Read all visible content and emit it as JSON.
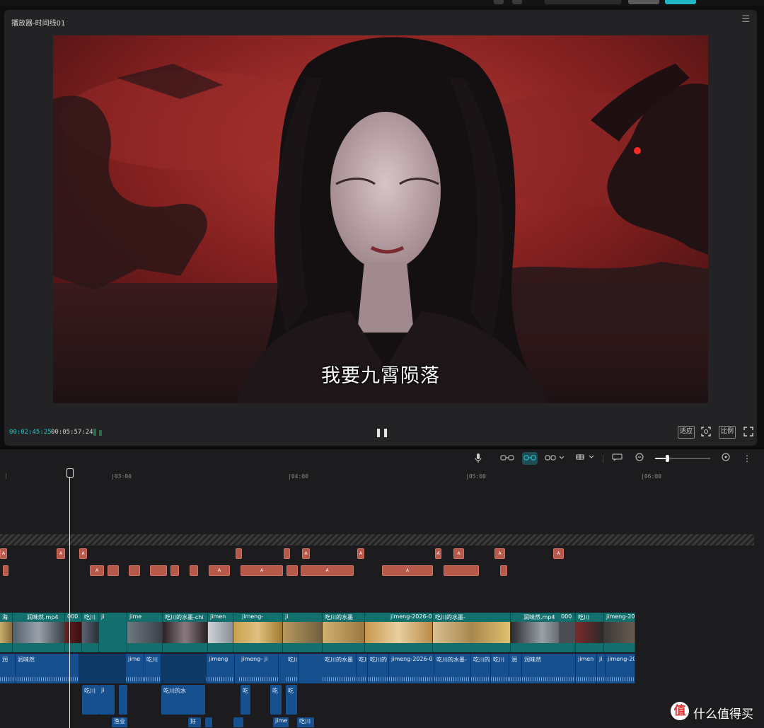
{
  "player": {
    "title": "播放器-时间线01",
    "subtitle": "我要九霄陨落",
    "current_time": "00:02:45:25",
    "total_time": "00:05:57:24",
    "ratio_label": "适应",
    "compare_label": "比例"
  },
  "timeline": {
    "ruler_ticks": [
      "|03:00",
      "|04:00",
      "|05:00",
      "|06:00"
    ],
    "video_clips": [
      "海",
      "润味然.mp4",
      "000",
      "吃川",
      "ji",
      "jime",
      "吃川的水墨-chi",
      "jimen",
      "jimeng-",
      "ji",
      "吃川的水墨",
      "jimeng-2026-0",
      "吃川的水墨-",
      "润味然.mp4",
      "000",
      "吃川",
      "jimeng-20"
    ],
    "audio_clips": [
      "润",
      "润味然",
      "jime",
      "吃川",
      "jimeng",
      "jimeng- ji",
      "吃川",
      "吃川的水墨",
      "吃川",
      "吃川的",
      "jimeng-2026-0",
      "吃川的水墨-",
      "吃川的",
      "吃川",
      "润",
      "润味然",
      "jimen",
      "ji",
      "jimeng-20"
    ],
    "audio2_clips": [
      "吃川",
      "ji",
      "吃川的水",
      "吃",
      "吃",
      "吃"
    ],
    "audio3_clips": [
      "渔业",
      "好",
      "jime",
      "吃川"
    ]
  },
  "watermark": {
    "logo": "值",
    "text": "什么值得买"
  },
  "colors": {
    "accent": "#19c8c8",
    "video_track": "#136f6e",
    "audio_track": "#17508e",
    "marker": "#b6584a"
  }
}
